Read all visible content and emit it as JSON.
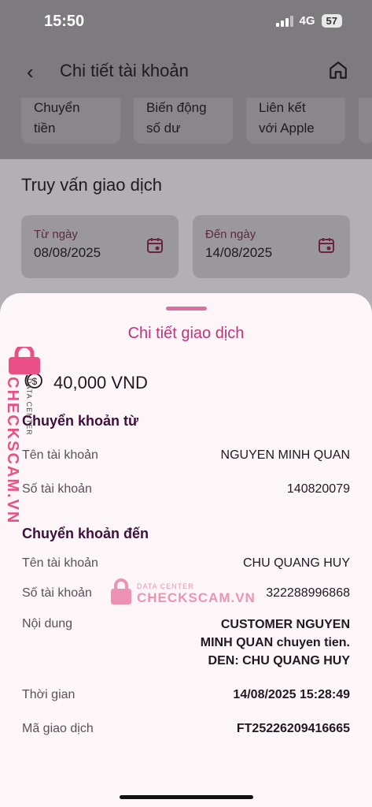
{
  "status_bar": {
    "time": "15:50",
    "network": "4G",
    "battery": "57"
  },
  "header": {
    "title": "Chi tiết tài khoản"
  },
  "quick_actions": [
    {
      "line1": "Chuyển",
      "line2": "tiền"
    },
    {
      "line1": "Biến động",
      "line2": "số dư"
    },
    {
      "line1": "Liên kết",
      "line2": "với Apple"
    }
  ],
  "query": {
    "title": "Truy vấn giao dịch",
    "from_label": "Từ ngày",
    "from_value": "08/08/2025",
    "to_label": "Đến ngày",
    "to_value": "14/08/2025"
  },
  "sheet": {
    "title": "Chi tiết giao dịch",
    "amount": "40,000 VND",
    "from_section": {
      "title": "Chuyển khoản từ",
      "name_label": "Tên tài khoản",
      "name_value": "NGUYEN MINH QUAN",
      "number_label": "Số tài khoản",
      "number_value": "140820079"
    },
    "to_section": {
      "title": "Chuyển khoản đến",
      "name_label": "Tên tài khoản",
      "name_value": "CHU QUANG HUY",
      "number_label": "Số tài khoản",
      "number_value": "322288996868"
    },
    "content_label": "Nội dung",
    "content_lines": [
      "CUSTOMER NGUYEN",
      "MINH QUAN chuyen tien.",
      "DEN: CHU QUANG HUY"
    ],
    "time_label": "Thời gian",
    "time_value": "14/08/2025 15:28:49",
    "txn_label": "Mã giao dịch",
    "txn_value": "FT25226209416665"
  },
  "watermark": {
    "brand": "CHECKSCAM.VN",
    "tag": "DATA CENTER"
  },
  "colors": {
    "accent": "#c3327a",
    "section_title": "#3d0f3a",
    "watermark": "#ea4f85"
  }
}
